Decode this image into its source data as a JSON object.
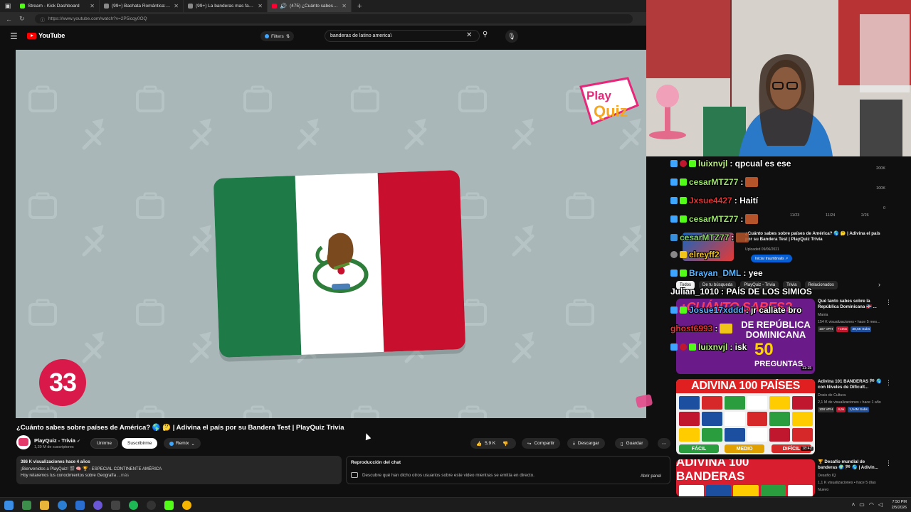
{
  "browser": {
    "tabs": [
      {
        "label": "Stream - Kick Dashboard",
        "color": "#53fc18",
        "active": false
      },
      {
        "label": "(99+) Bachata Romántica: Era No",
        "color": "#8a8a8a",
        "active": false
      },
      {
        "label": "(99+) La banderas mas facil y no h",
        "color": "#8a8a8a",
        "active": false
      },
      {
        "label": "(475) ¿Cuánto sabes sobre p",
        "color": "#ff0033",
        "active": true
      }
    ],
    "new_tab": "+",
    "url": "https://www.youtube.com/watch?v=2P5icqy0OQ"
  },
  "masthead": {
    "logo": "YouTube",
    "filters_label": "Filters",
    "search_query": "banderas  de latino america\\"
  },
  "video": {
    "logo_line1": "Play",
    "logo_line2": "Quiz",
    "timer": "33",
    "background": "#a9b7b8"
  },
  "info": {
    "title": "¿Cuánto sabes sobre países de América? 🌎 🤔 | Adivina el país por su Bandera Test | PlayQuiz Trivia",
    "channel": "PlayQuiz - Trivia",
    "subscribers": "1,39 M de suscriptores",
    "join": "Unirme",
    "subscribe": "Suscribirme",
    "remix": "Remix",
    "likes": "5,9 K",
    "share": "Compartir",
    "download": "Descargar",
    "save": "Guardar",
    "more": "⋯",
    "views_line": "386 K visualizaciones  hace 4 años",
    "desc_line1": "¡Bienvenidos a PlayQuiz! 🎬 🧠 🏆 - ESPECIAL CONTINENTE AMÉRICA",
    "desc_line2": "Hoy retaremos tus conocimientos sobre Geografía",
    "desc_more": "...más",
    "chat_title": "Reproducción del chat",
    "chat_desc": "Descubre qué han dicho otros usuarios sobre este video mientras se emitía en directo.",
    "chat_open": "Abrir panel"
  },
  "sidebar": {
    "chips": [
      "Todos",
      "De tu búsqueda",
      "PlayQuiz - Trivia",
      "Trivia",
      "Relacionados"
    ],
    "stats": {
      "y_labels": [
        "200K",
        "100K",
        "0"
      ],
      "x_labels": [
        "11/23",
        "11/24",
        "2/26"
      ]
    },
    "ad": {
      "title": "¿Cuánto sabes sobre países de América? 🌎 🤔 | Adivina el país por su Bandera Test | PlayQuiz Trivia",
      "date": "Uploaded 09/06/2021",
      "button": "Iniciar traumbnails ↗"
    },
    "recs": [
      {
        "thumb_a": "¿CUÁNTO SABES?",
        "thumb_b": "DE REPÚBLICA DOMINICANA",
        "thumb_c": "50",
        "thumb_d": "PREGUNTAS",
        "duration": "11:15",
        "title": "Qué tanto sabes sobre la República Dominicana 🇩🇴 ...",
        "channel": "Mania",
        "meta": "154 K visualizaciones • hace 5 mes...",
        "badges": [
          [
            "107 VPH",
            "#333"
          ],
          [
            "+100x",
            "#c0172f"
          ],
          [
            "38,5K Subs",
            "#1e4e9c"
          ]
        ]
      },
      {
        "thumb_a": "ADIVINA 100 PAÍSES",
        "level1": "FÁCIL",
        "level2": "MEDIO",
        "level3": "DIFÍCIL",
        "duration": "18:42",
        "title": "Adivina 101 BANDERAS 🏁 🌎 con Niveles de Dificult...",
        "channel": "Dosis de Cultura",
        "meta": "2,1 M de visualizaciones • hace 1 año",
        "badges": [
          [
            "108 VPH",
            "#333"
          ],
          [
            "4,6x",
            "#c0172f"
          ],
          [
            "1,54M Subs",
            "#1e4e9c"
          ]
        ]
      },
      {
        "thumb_a": "ADIVINA 100 BANDERAS",
        "title": "🏆 Desafío mundial de banderas 🌍 🏁 🌎 | Adivin...",
        "channel": "Desafío IQ",
        "meta": "1,1 K visualizaciones • hace 5 días",
        "new": "Nuevo"
      }
    ]
  },
  "stream_chat": [
    {
      "user": "luixnvjl",
      "text": ": qpcual es ese",
      "color": "#b9f27c"
    },
    {
      "user": "cesarMTZ77",
      "text": " :",
      "color": "#9be36a",
      "emote": true
    },
    {
      "user": "Jxsue4427",
      "text": ": Haití",
      "color": "#e23636"
    },
    {
      "user": "cesarMTZ77",
      "text": " :",
      "color": "#9be36a",
      "emote": true
    },
    {
      "user": "cesarMTZ77",
      "text": " :",
      "color": "#9be36a",
      "emote": true
    },
    {
      "user": "elreyff2",
      "text": "",
      "color": "#f0c419"
    },
    {
      "user": "Brayan_DML",
      "text": ": yee",
      "color": "#5ab4ff"
    },
    {
      "user": "Julian_1010",
      "text": ": PAÍS DE LOS SIMIOS",
      "color": "#ffffff"
    },
    {
      "user": "Josue17xddd",
      "text": ": jr callate bro",
      "color": "#5ab4ff"
    },
    {
      "user": "ghost6993",
      "text": " :",
      "color": "#e23636",
      "emote": true
    },
    {
      "user": "luixnvjl",
      "text": ": isk",
      "color": "#b9f27c"
    }
  ],
  "taskbar": {
    "time": "7:50 PM",
    "date": "2/5/2026"
  }
}
